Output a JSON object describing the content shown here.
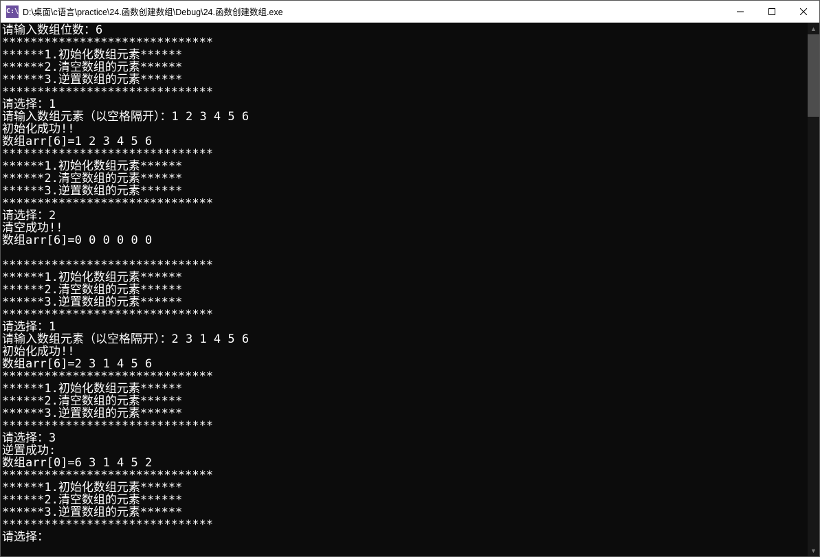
{
  "window": {
    "app_icon_text": "C:\\",
    "title": "D:\\桌面\\c语言\\practice\\24.函数创建数组\\Debug\\24.函数创建数组.exe"
  },
  "console": {
    "lines": [
      "请输入数组位数：6",
      "******************************",
      "******1.初始化数组元素******",
      "******2.清空数组的元素******",
      "******3.逆置数组的元素******",
      "******************************",
      "请选择：1",
      "请输入数组元素（以空格隔开）：1 2 3 4 5 6",
      "初始化成功!!",
      "数组arr[6]=1 2 3 4 5 6",
      "******************************",
      "******1.初始化数组元素******",
      "******2.清空数组的元素******",
      "******3.逆置数组的元素******",
      "******************************",
      "请选择：2",
      "清空成功!!",
      "数组arr[6]=0 0 0 0 0 0",
      "",
      "******************************",
      "******1.初始化数组元素******",
      "******2.清空数组的元素******",
      "******3.逆置数组的元素******",
      "******************************",
      "请选择：1",
      "请输入数组元素（以空格隔开）：2 3 1 4 5 6",
      "初始化成功!!",
      "数组arr[6]=2 3 1 4 5 6",
      "******************************",
      "******1.初始化数组元素******",
      "******2.清空数组的元素******",
      "******3.逆置数组的元素******",
      "******************************",
      "请选择：3",
      "逆置成功:",
      "数组arr[0]=6 3 1 4 5 2",
      "******************************",
      "******1.初始化数组元素******",
      "******2.清空数组的元素******",
      "******3.逆置数组的元素******",
      "******************************",
      "请选择："
    ]
  }
}
